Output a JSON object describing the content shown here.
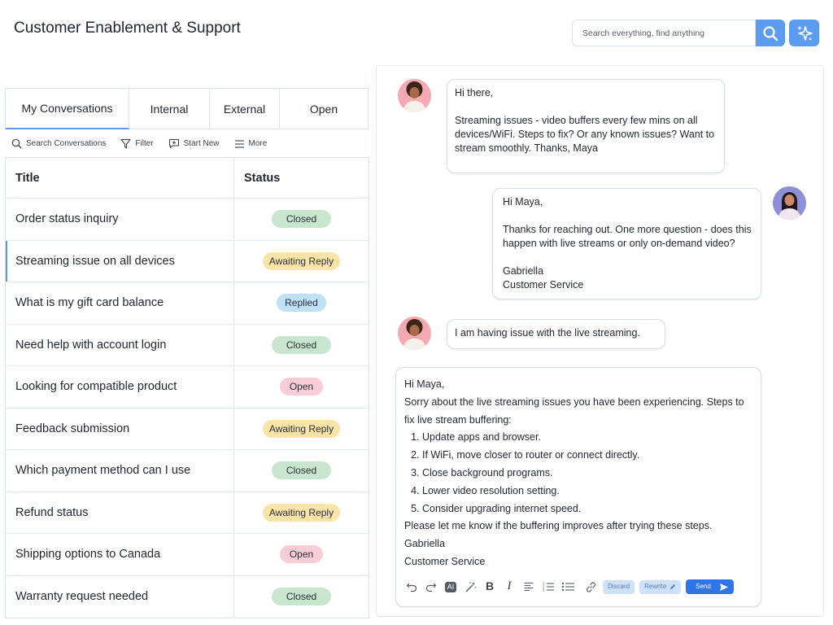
{
  "header": {
    "title": "Customer Enablement & Support",
    "search_placeholder": "Search everything, find anything"
  },
  "tabs": [
    {
      "label": "My Conversations",
      "active": true
    },
    {
      "label": "Internal",
      "active": false
    },
    {
      "label": "External",
      "active": false
    },
    {
      "label": "Open",
      "active": false
    }
  ],
  "toolbar": {
    "search": "Search Conversations",
    "filter": "Filter",
    "start_new": "Start New",
    "more": "More"
  },
  "table": {
    "headers": {
      "title": "Title",
      "status": "Status"
    },
    "rows": [
      {
        "title": "Order status inquiry",
        "status": "Closed"
      },
      {
        "title": "Streaming issue on all devices",
        "status": "Awaiting Reply"
      },
      {
        "title": "What is my gift card balance",
        "status": "Replied"
      },
      {
        "title": "Need help with account login",
        "status": "Closed"
      },
      {
        "title": "Looking for compatible product",
        "status": "Open"
      },
      {
        "title": "Feedback submission",
        "status": "Awaiting Reply"
      },
      {
        "title": "Which payment method can I use",
        "status": "Closed"
      },
      {
        "title": "Refund status",
        "status": "Awaiting Reply"
      },
      {
        "title": "Shipping options to Canada",
        "status": "Open"
      },
      {
        "title": "Warranty request needed",
        "status": "Closed"
      }
    ]
  },
  "messages": [
    {
      "from": "customer",
      "text": "Hi there,\n\nStreaming issues - video buffers every few mins on all devices/WiFi. Steps to fix? Or any known issues? Want to stream smoothly. Thanks, Maya"
    },
    {
      "from": "agent",
      "text": "Hi Maya,\n\nThanks for reaching out. One more question - does this happen with live streams or only on-demand video?\n\nGabriella\nCustomer Service"
    },
    {
      "from": "customer",
      "text": "I am having issue with the live streaming."
    }
  ],
  "composer": {
    "greeting": "Hi Maya,",
    "intro": "Sorry about the live streaming issues you have been experiencing. Steps to fix live stream buffering:",
    "steps": [
      "Update apps and browser.",
      "If WiFi, move closer to router or connect directly.",
      "Close background programs.",
      "Lower video resolution setting.",
      "Consider upgrading internet speed."
    ],
    "closing": "Please let me know if the buffering improves after trying these steps.",
    "signature_name": "Gabriella",
    "signature_title": "Customer Service",
    "ai_label": "AI",
    "discard_label": "Discard",
    "rewrite_label": "Rewrite",
    "send_label": "Send"
  },
  "colors": {
    "accent": "#5b9cf1",
    "send": "#2f74e8",
    "closed": "#c8e6cd",
    "awaiting": "#fbe4a8",
    "replied": "#bfe0f5",
    "open": "#f8cdd6"
  }
}
